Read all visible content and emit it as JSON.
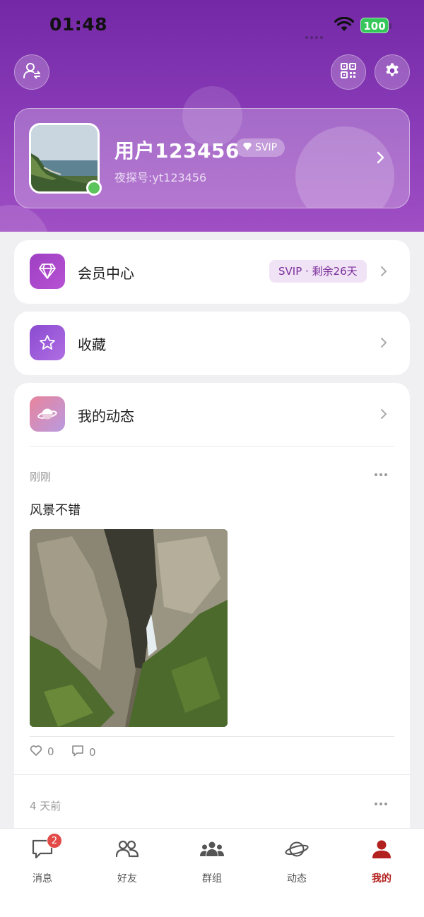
{
  "status_bar": {
    "time": "01:48",
    "battery": "100"
  },
  "profile": {
    "username": "用户123456",
    "svip_tag": "SVIP",
    "user_id": "夜探号:yt123456"
  },
  "menu": {
    "vip_center": {
      "label": "会员中心",
      "badge": "SVIP · 剩余26天"
    },
    "favorites": {
      "label": "收藏"
    },
    "my_posts": {
      "label": "我的动态"
    }
  },
  "posts": [
    {
      "time": "刚刚",
      "text": "风景不错",
      "likes": "0",
      "comments": "0"
    },
    {
      "time": "4 天前"
    }
  ],
  "tab_bar": {
    "items": [
      {
        "label": "消息",
        "badge": "2"
      },
      {
        "label": "好友"
      },
      {
        "label": "群组"
      },
      {
        "label": "动态"
      },
      {
        "label": "我的"
      }
    ]
  },
  "colors": {
    "header_top": "#7428a6",
    "header_bottom": "#a04fc4",
    "accent_active": "#b3211f",
    "badge_red": "#e24b48",
    "vip_badge_bg": "#f1e3f6",
    "vip_badge_text": "#7a2e9a"
  }
}
